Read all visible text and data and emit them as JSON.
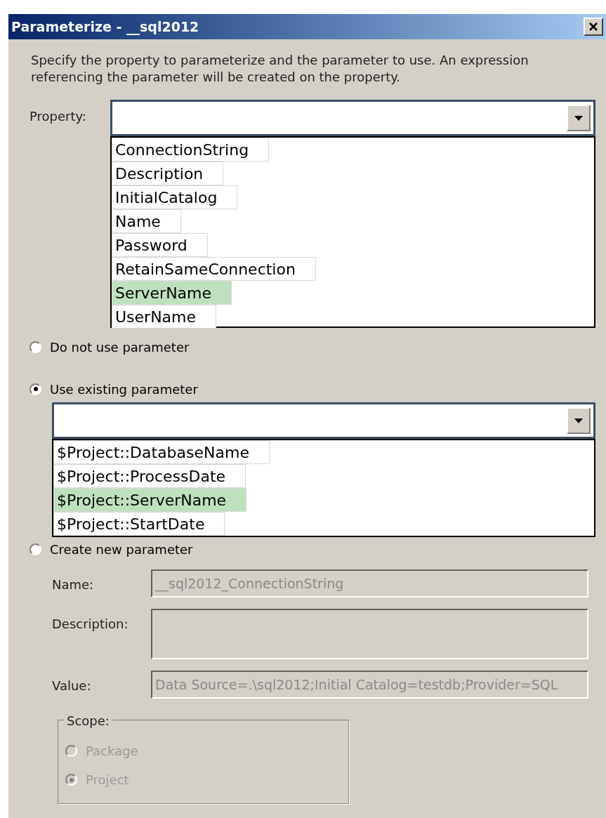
{
  "window": {
    "title": "Parameterize - __sql2012"
  },
  "description": "Specify the property to parameterize and the parameter to use. An expression referencing the parameter will be created on the property.",
  "property": {
    "label": "Property:",
    "options": [
      {
        "label": "ConnectionString",
        "selected": false
      },
      {
        "label": "Description",
        "selected": false
      },
      {
        "label": "InitialCatalog",
        "selected": false
      },
      {
        "label": "Name",
        "selected": false
      },
      {
        "label": "Password",
        "selected": false
      },
      {
        "label": "RetainSameConnection",
        "selected": false
      },
      {
        "label": "ServerName",
        "selected": true
      },
      {
        "label": "UserName",
        "selected": false
      }
    ]
  },
  "mode_options": [
    {
      "label": "Do not use parameter",
      "selected": false
    },
    {
      "label": "Use existing parameter",
      "selected": true
    },
    {
      "label": "Create new parameter",
      "selected": false
    }
  ],
  "existing_parameter": {
    "options": [
      {
        "label": "$Project::DatabaseName",
        "selected": false
      },
      {
        "label": "$Project::ProcessDate",
        "selected": false
      },
      {
        "label": "$Project::ServerName",
        "selected": true
      },
      {
        "label": "$Project::StartDate",
        "selected": false
      }
    ]
  },
  "new_parameter": {
    "disabled": true,
    "name": {
      "label": "Name:",
      "value": "__sql2012_ConnectionString"
    },
    "description": {
      "label": "Description:"
    },
    "value": {
      "label": "Value:",
      "value": "Data Source=.\\sql2012;Initial Catalog=testdb;Provider=SQL"
    },
    "scope": {
      "label": "Scope:",
      "options": [
        {
          "label": "Package",
          "selected": false
        },
        {
          "label": "Project",
          "selected": true
        }
      ]
    }
  }
}
